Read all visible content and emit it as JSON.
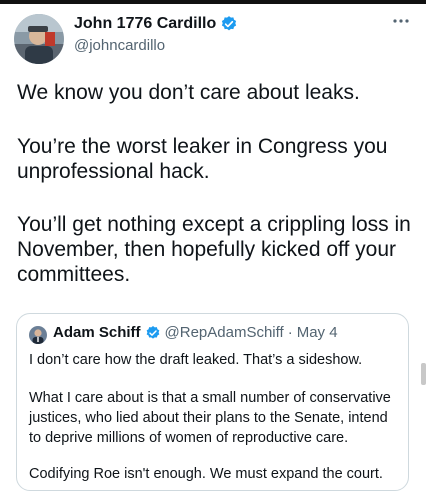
{
  "tweet": {
    "author_name": "John 1776 Cardillo",
    "author_handle": "@johncardillo",
    "more_icon": "more-horizontal-icon",
    "verified_icon": "verified-badge-icon",
    "text": {
      "p1": "We know you don’t care about leaks.",
      "p2": "You’re the worst leaker in Congress you unprofessional hack.",
      "p3": "You’ll get nothing except a crippling loss in November, then hopefully kicked off your committees."
    }
  },
  "quoted_tweet": {
    "author_name": "Adam Schiff",
    "author_handle": "@RepAdamSchiff",
    "separator": "·",
    "date": "May 4",
    "text": {
      "p1": "I don’t care how the draft leaked. That’s a sideshow.",
      "p2": "What I care about is that a small number of conservative justices, who lied about their plans to the Senate, intend to deprive millions of women of reproductive care.",
      "p3": "Codifying Roe isn't enough. We must expand the court."
    }
  },
  "colors": {
    "verified_blue": "#1d9bf0",
    "text_primary": "#0f1419",
    "text_secondary": "#536471",
    "card_border": "#cfd9de"
  }
}
